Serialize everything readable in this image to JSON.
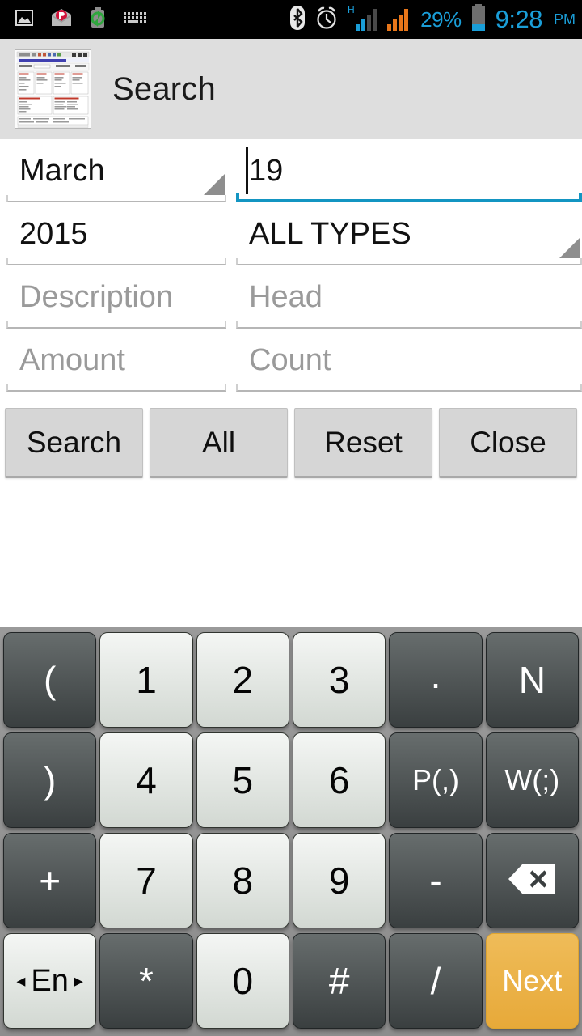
{
  "status_bar": {
    "left_icons": [
      {
        "name": "image-icon",
        "label": "image"
      },
      {
        "name": "mail-icon",
        "label": "mail"
      },
      {
        "name": "battery-sync-icon",
        "label": "battery-sync"
      },
      {
        "name": "keyboard-icon",
        "label": "keyboard"
      }
    ],
    "right_icons": [
      {
        "name": "bluetooth-icon",
        "label": "bluetooth"
      },
      {
        "name": "alarm-icon",
        "label": "alarm"
      },
      {
        "name": "signal-h-icon",
        "label": "H"
      },
      {
        "name": "signal-icon",
        "label": "signal"
      }
    ],
    "battery_percent": "29%",
    "time": "9:28",
    "ampm": "PM",
    "accent_color": "#1a9ed8",
    "background": "#000000"
  },
  "action_bar": {
    "title": "Search",
    "icon_name": "app-thumbnail-icon",
    "background": "#dedede"
  },
  "form": {
    "month": {
      "value": "March",
      "type": "spinner"
    },
    "day": {
      "value": "19",
      "focused": true,
      "underline_color": "#1395c2"
    },
    "year": {
      "value": "2015",
      "type": "input"
    },
    "type": {
      "value": "ALL TYPES",
      "type": "spinner"
    },
    "description": {
      "value": "",
      "placeholder": "Description"
    },
    "head": {
      "value": "",
      "placeholder": "Head"
    },
    "amount": {
      "value": "",
      "placeholder": "Amount"
    },
    "count": {
      "value": "",
      "placeholder": "Count"
    }
  },
  "buttons": [
    {
      "name": "search-button",
      "label": "Search"
    },
    {
      "name": "all-button",
      "label": "All"
    },
    {
      "name": "reset-button",
      "label": "Reset"
    },
    {
      "name": "close-button",
      "label": "Close"
    }
  ],
  "keyboard": {
    "accent_color": "#ecb44a",
    "rows": [
      [
        {
          "name": "key-open-paren",
          "label": "(",
          "style": "dark",
          "size": "normal"
        },
        {
          "name": "key-1",
          "label": "1",
          "style": "light",
          "size": "normal"
        },
        {
          "name": "key-2",
          "label": "2",
          "style": "light",
          "size": "normal"
        },
        {
          "name": "key-3",
          "label": "3",
          "style": "light",
          "size": "normal"
        },
        {
          "name": "key-period",
          "label": ".",
          "style": "dark",
          "size": "dot"
        },
        {
          "name": "key-n",
          "label": "N",
          "style": "dark",
          "size": "normal"
        }
      ],
      [
        {
          "name": "key-close-paren",
          "label": ")",
          "style": "dark",
          "size": "normal"
        },
        {
          "name": "key-4",
          "label": "4",
          "style": "light",
          "size": "normal"
        },
        {
          "name": "key-5",
          "label": "5",
          "style": "light",
          "size": "normal"
        },
        {
          "name": "key-6",
          "label": "6",
          "style": "light",
          "size": "normal"
        },
        {
          "name": "key-pause",
          "label": "P(,)",
          "style": "dark",
          "size": "small"
        },
        {
          "name": "key-wait",
          "label": "W(;)",
          "style": "dark",
          "size": "small"
        }
      ],
      [
        {
          "name": "key-plus",
          "label": "+",
          "style": "dark",
          "size": "normal"
        },
        {
          "name": "key-7",
          "label": "7",
          "style": "light",
          "size": "normal"
        },
        {
          "name": "key-8",
          "label": "8",
          "style": "light",
          "size": "normal"
        },
        {
          "name": "key-9",
          "label": "9",
          "style": "light",
          "size": "normal"
        },
        {
          "name": "key-minus",
          "label": "-",
          "style": "dark",
          "size": "normal"
        },
        {
          "name": "key-backspace",
          "label": "",
          "style": "dark",
          "size": "icon"
        }
      ],
      [
        {
          "name": "key-language",
          "label": "En",
          "style": "light",
          "size": "lang"
        },
        {
          "name": "key-asterisk",
          "label": "*",
          "style": "dark",
          "size": "normal"
        },
        {
          "name": "key-0",
          "label": "0",
          "style": "light",
          "size": "normal"
        },
        {
          "name": "key-hash",
          "label": "#",
          "style": "dark",
          "size": "normal"
        },
        {
          "name": "key-slash",
          "label": "/",
          "style": "dark",
          "size": "normal"
        },
        {
          "name": "key-next",
          "label": "Next",
          "style": "accent",
          "size": "small"
        }
      ]
    ],
    "lang_arrow_left": "◂",
    "lang_arrow_right": "▸"
  }
}
